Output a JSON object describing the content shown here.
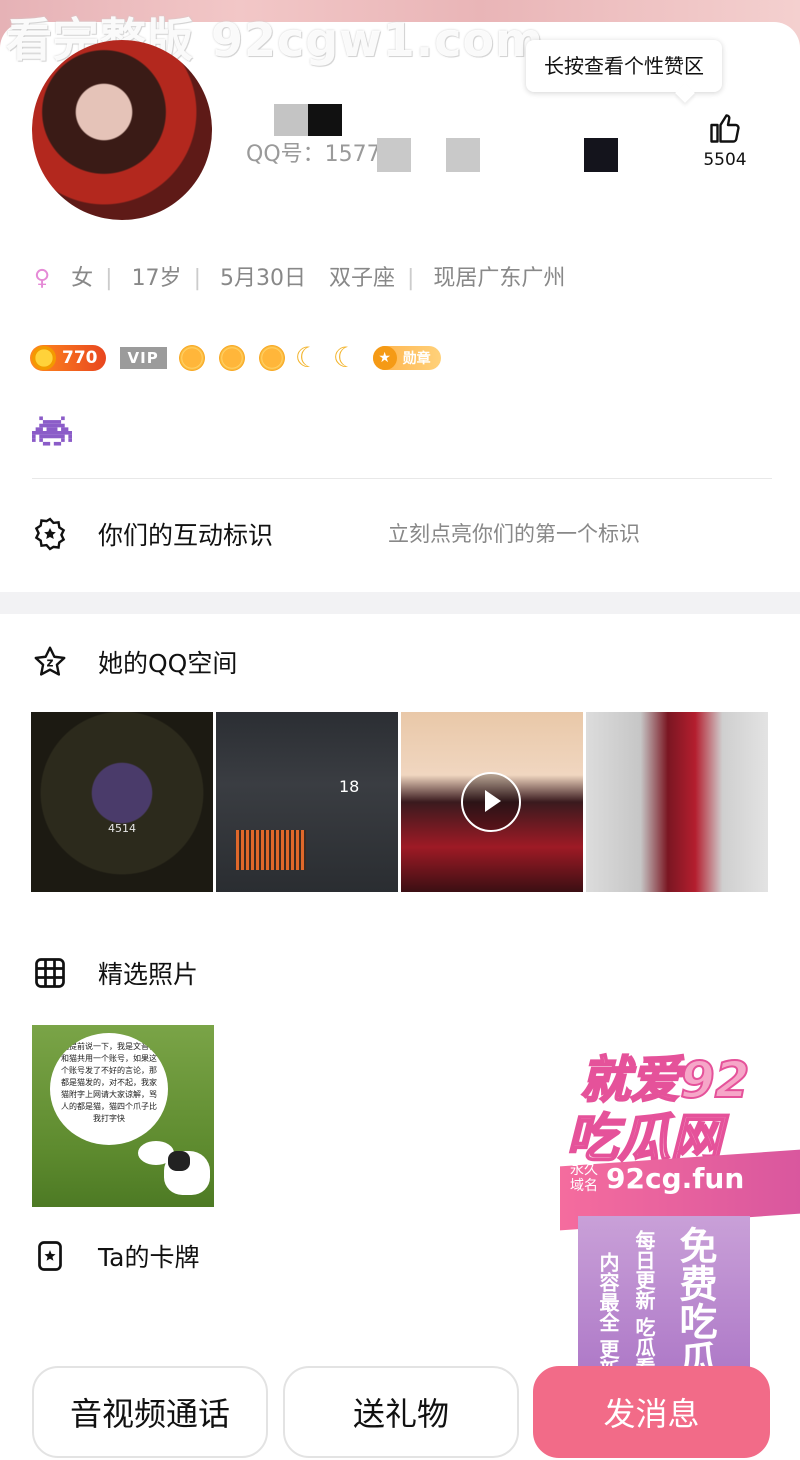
{
  "watermark": {
    "top": "看完整版 92cgw1.com"
  },
  "tooltip": {
    "text": "长按查看个性赞区"
  },
  "profile": {
    "qq_prefix": "QQ号：1577",
    "like_count": "5504",
    "gender_symbol": "♀",
    "gender": "女",
    "age": "17岁",
    "birthday": "5月30日",
    "zodiac": "双子座",
    "location": "现居广东广州"
  },
  "badges": {
    "coins": "770",
    "vip": "VIP",
    "medal": "勋章"
  },
  "interaction": {
    "label": "你们的互动标识",
    "hint": "立刻点亮你们的第一个标识"
  },
  "qzone": {
    "label": "她的QQ空间",
    "thumbs": [
      {
        "caption": "4514"
      },
      {
        "caption": "18"
      },
      {
        "caption": ""
      },
      {
        "caption": ""
      }
    ]
  },
  "photos": {
    "label": "精选照片",
    "bubble_text": "我提前说一下，我是文音，和猫共用一个账号，如果这个账号发了不好的言论，那都是猫发的，对不起，我家猫附字上网请大家谅解，骂人的都是猫，猫四个爪子比我打字快"
  },
  "cards": {
    "label": "Ta的卡牌"
  },
  "buttons": {
    "call": "音视频通话",
    "gift": "送礼物",
    "message": "发消息"
  },
  "promo": {
    "line1": "就爱92",
    "line2": "吃瓜网",
    "domain_pre": "永久域名",
    "domain": "92cg.fun",
    "col1": "免费吃瓜",
    "col2": "每日更新 吃瓜看戏",
    "col3": "内容最全 更新最快"
  },
  "colors": {
    "accent_pink": "#f26b88",
    "gray_text": "#888888",
    "gender": "#e58ad6"
  }
}
